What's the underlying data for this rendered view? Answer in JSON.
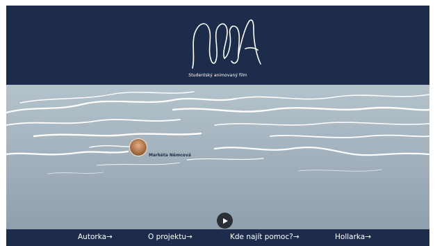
{
  "header": {
    "logo_name": "VODA wordmark",
    "subtitle": "Studentský animovaný film"
  },
  "scene": {
    "person": {
      "name": "Markéta Němcová"
    },
    "play_icon": "play-icon"
  },
  "footer": {
    "nav": [
      {
        "label": "Autorka→"
      },
      {
        "label": "O projektu→"
      },
      {
        "label": "Kde najít pomoc?→"
      },
      {
        "label": "Hollarka→"
      }
    ]
  },
  "colors": {
    "navy": "#1e2c4b",
    "water_top": "#b4c2cb",
    "water_bottom": "#8f9fad"
  }
}
